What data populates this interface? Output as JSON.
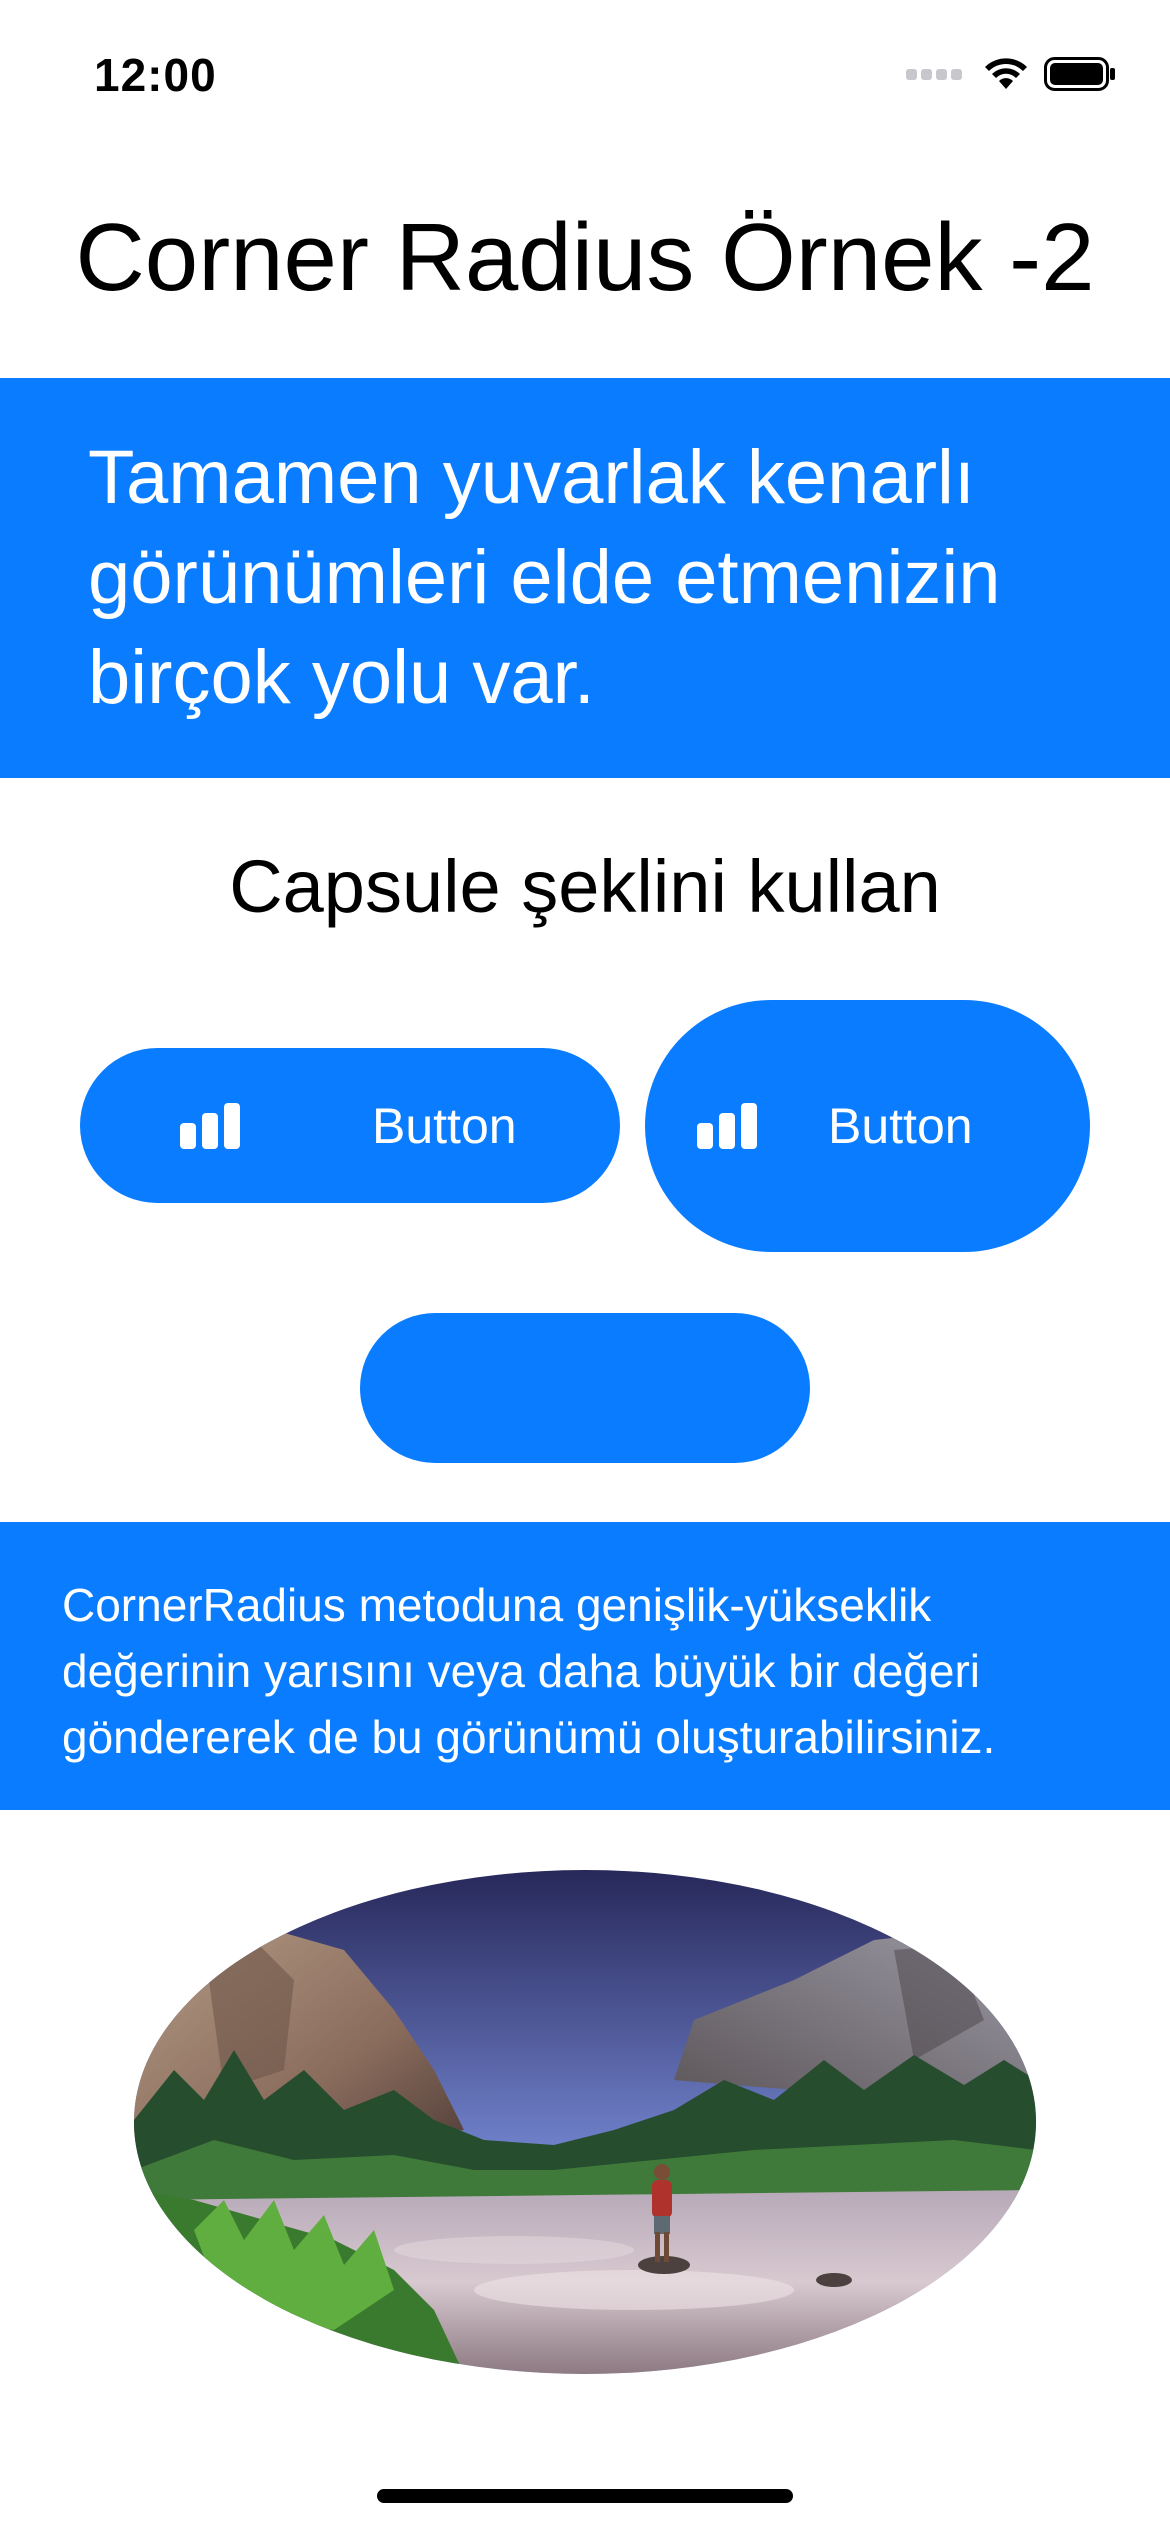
{
  "status_bar": {
    "time": "12:00",
    "icons": [
      "cellular-signal-icon",
      "wifi-icon",
      "battery-icon"
    ]
  },
  "title": "Corner Radius Örnek -2",
  "intro_banner": {
    "text": "Tamamen yuvarlak kenarlı görünümleri elde etmenizin birçok yolu var."
  },
  "section_heading": "Capsule şeklini kullan",
  "buttons": [
    {
      "label": "Button",
      "icon": "chart-bar-icon"
    },
    {
      "label": "Button",
      "icon": "chart-bar-icon"
    }
  ],
  "note_banner": {
    "text": "CornerRadius metoduna genişlik-yükseklik değerinin yarısını veya daha büyük bir değeri göndererek de bu görünümü oluşturabilirsiniz."
  },
  "photo": {
    "subject": "mountain-valley-river-photo"
  },
  "colors": {
    "accent": "#0a7cff",
    "text_on_accent": "#ffffff",
    "background": "#ffffff"
  }
}
